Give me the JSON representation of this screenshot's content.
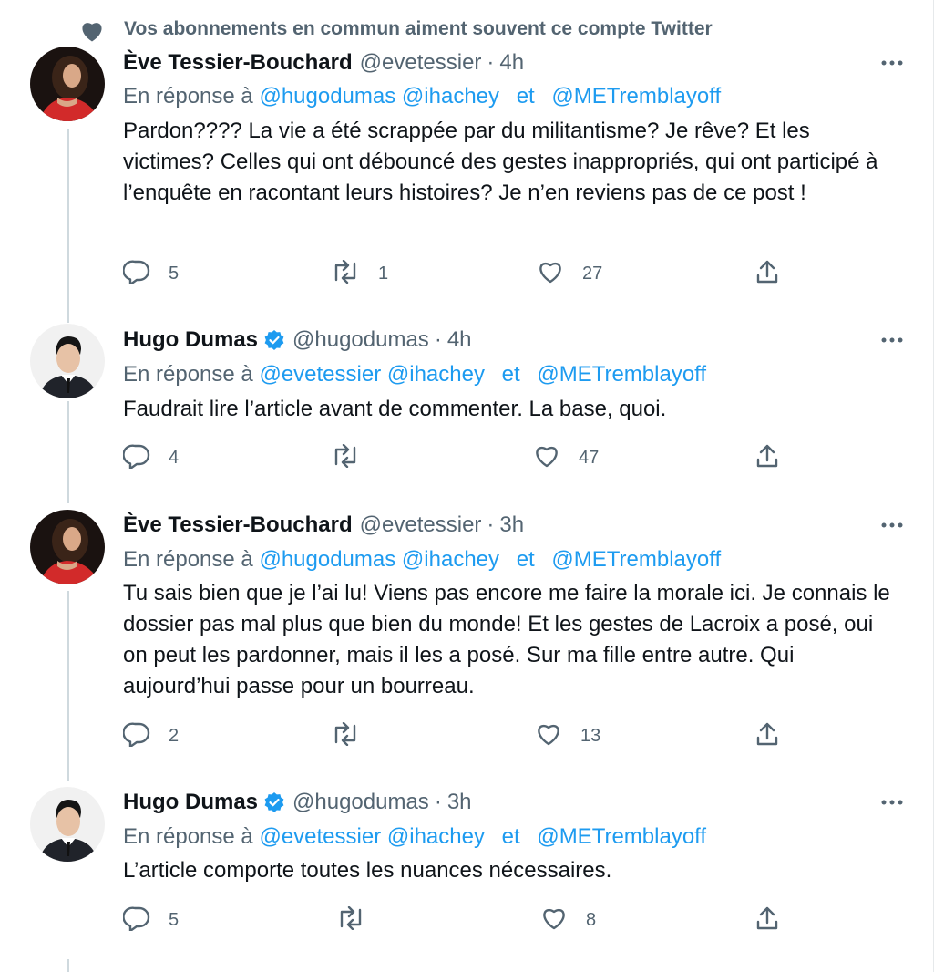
{
  "social_context": {
    "text": "Vos abonnements en commun aiment souvent ce compte Twitter",
    "icon": "heart-icon"
  },
  "reply_prefix": "En réponse à",
  "reply_joiner": "et",
  "colors": {
    "accent": "#1d9bf0",
    "muted": "#536471",
    "text": "#0f1419",
    "thread": "#cfd9de"
  },
  "tweets": [
    {
      "name": "Ève Tessier-Bouchard",
      "handle": "@evetessier",
      "time": "4h",
      "verified": false,
      "reply_mentions": [
        "@hugodumas",
        "@ihachey",
        "@METremblayoff"
      ],
      "text": "Pardon???? La vie a été scrappée par du militantisme? Je rêve? Et les victimes? Celles qui ont débouncé des gestes inappropriés, qui ont participé à l’enquête en racontant leurs histoires? Je n’en reviens pas de ce post !",
      "counts": {
        "replies": "5",
        "retweets": "1",
        "likes": "27"
      }
    },
    {
      "name": "Hugo Dumas",
      "handle": "@hugodumas",
      "time": "4h",
      "verified": true,
      "reply_mentions": [
        "@evetessier",
        "@ihachey",
        "@METremblayoff"
      ],
      "text": "Faudrait lire l’article avant de commenter. La base, quoi.",
      "counts": {
        "replies": "4",
        "retweets": "",
        "likes": "47"
      }
    },
    {
      "name": "Ève Tessier-Bouchard",
      "handle": "@evetessier",
      "time": "3h",
      "verified": false,
      "reply_mentions": [
        "@hugodumas",
        "@ihachey",
        "@METremblayoff"
      ],
      "text": "Tu sais bien que je l’ai lu! Viens pas encore me faire la morale ici. Je connais le dossier pas mal plus que bien du monde! Et les gestes de Lacroix a posé, oui on peut les pardonner, mais il les a posé. Sur ma fille entre autre. Qui aujourd’hui passe pour un bourreau.",
      "counts": {
        "replies": "2",
        "retweets": "",
        "likes": "13"
      }
    },
    {
      "name": "Hugo Dumas",
      "handle": "@hugodumas",
      "time": "3h",
      "verified": true,
      "reply_mentions": [
        "@evetessier",
        "@ihachey",
        "@METremblayoff"
      ],
      "text": "L’article comporte toutes les nuances nécessaires.",
      "counts": {
        "replies": "5",
        "retweets": "",
        "likes": "8"
      }
    }
  ]
}
